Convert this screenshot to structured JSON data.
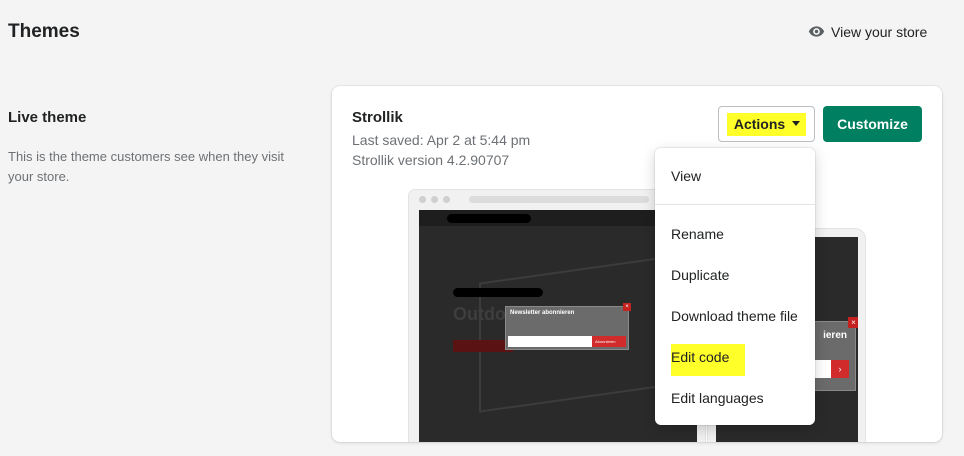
{
  "header": {
    "title": "Themes",
    "view_store_label": "View your store",
    "view_store_icon": "eye-icon"
  },
  "live_theme_section": {
    "title": "Live theme",
    "description": "This is the theme customers see when they visit your store."
  },
  "theme_card": {
    "name": "Strollik",
    "last_saved": "Last saved: Apr 2 at 5:44 pm",
    "version": "Strollik version 4.2.90707",
    "actions_label": "Actions",
    "customize_label": "Customize",
    "preview": {
      "hero_text": "Outdo",
      "popup_title": "Newsletter abonnieren",
      "popup_button": "Abonnieren",
      "mobile_popup_title": "ieren"
    }
  },
  "actions_menu": {
    "items": [
      {
        "label": "View"
      },
      {
        "label": "Rename"
      },
      {
        "label": "Duplicate"
      },
      {
        "label": "Download theme file"
      },
      {
        "label": "Edit code"
      },
      {
        "label": "Edit languages"
      }
    ]
  },
  "colors": {
    "background": "#f4f4f4",
    "primary_button": "#008060",
    "highlight": "#ffff2a"
  }
}
